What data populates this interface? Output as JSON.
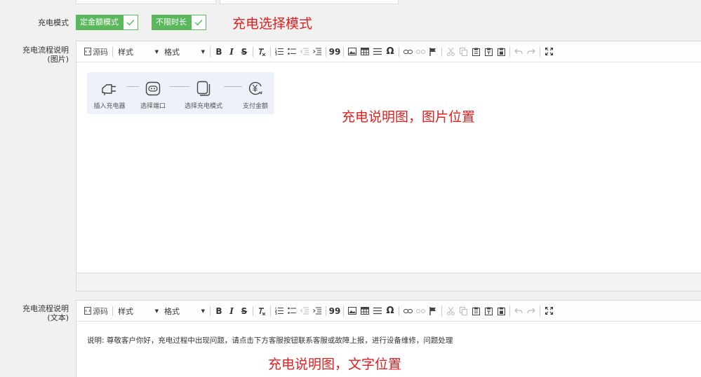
{
  "mode_row": {
    "label": "充电模式",
    "options": [
      {
        "label": "定金额模式",
        "checked": true
      },
      {
        "label": "不限时长",
        "checked": true
      }
    ],
    "note": "充电选择模式"
  },
  "flow_image_row": {
    "label_line1": "充电流程说明",
    "label_line2": "(图片)",
    "steps": [
      {
        "label": "插入充电器",
        "icon": "plug-icon"
      },
      {
        "label": "选择端口",
        "icon": "socket-icon"
      },
      {
        "label": "选择充电模式",
        "icon": "mode-icon"
      },
      {
        "label": "支付金额",
        "icon": "yuan-pay-icon"
      }
    ],
    "note": "充电说明图，图片位置"
  },
  "flow_text_row": {
    "label_line1": "充电流程说明",
    "label_line2": "(文本)",
    "content": "说明: 尊敬客户你好，充电过程中出现问题，请点击下方客服按钮联系客服或故障上报，进行设备维修，问题处理",
    "note": "充电说明图，文字位置"
  },
  "toolbar": {
    "source_label": "源码",
    "style_label": "样式",
    "format_label": "格式",
    "bold": "B",
    "italic": "I",
    "strike": "S",
    "clear_format": "Tx",
    "quote": "99",
    "special_char": "Ω"
  },
  "colors": {
    "accent_green": "#5cb85c",
    "note_red": "#e02020",
    "flow_bg": "#edf1f9"
  }
}
